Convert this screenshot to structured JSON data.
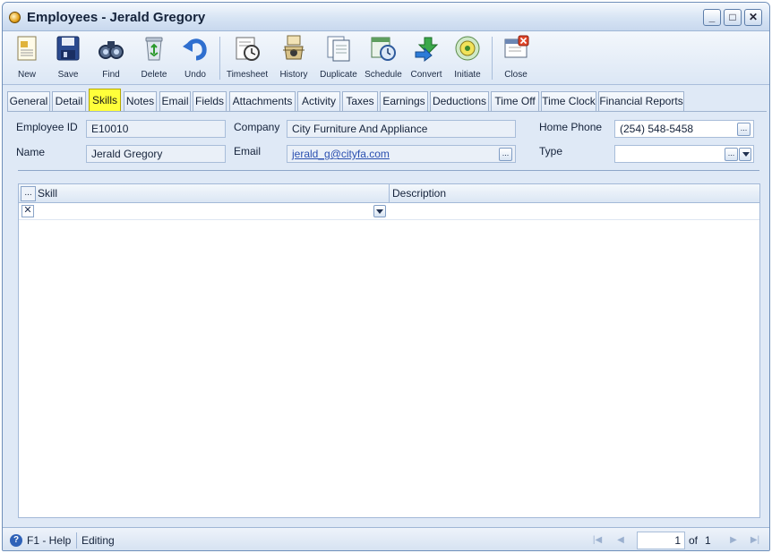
{
  "window": {
    "title": "Employees - Jerald Gregory"
  },
  "toolbar": {
    "buttons": [
      {
        "label": "New",
        "icon": "new-document-icon"
      },
      {
        "label": "Save",
        "icon": "floppy-disk-icon"
      },
      {
        "label": "Find",
        "icon": "binoculars-icon"
      },
      {
        "label": "Delete",
        "icon": "recycle-bin-icon"
      },
      {
        "label": "Undo",
        "icon": "undo-arrow-icon"
      },
      {
        "label": "Timesheet",
        "icon": "timesheet-clock-icon"
      },
      {
        "label": "History",
        "icon": "history-icon"
      },
      {
        "label": "Duplicate",
        "icon": "duplicate-icon"
      },
      {
        "label": "Schedule",
        "icon": "schedule-icon"
      },
      {
        "label": "Convert",
        "icon": "convert-arrows-icon"
      },
      {
        "label": "Initiate",
        "icon": "initiate-icon"
      },
      {
        "label": "Close",
        "icon": "close-window-icon"
      }
    ]
  },
  "tabs": [
    "General",
    "Detail",
    "Skills",
    "Notes",
    "Email",
    "Fields",
    "Attachments",
    "Activity",
    "Taxes",
    "Earnings",
    "Deductions",
    "Time Off",
    "Time Clock",
    "Financial Reports"
  ],
  "active_tab": "Skills",
  "form": {
    "employee_id_label": "Employee ID",
    "employee_id": "E10010",
    "name_label": "Name",
    "name": "Jerald Gregory",
    "company_label": "Company",
    "company": "City Furniture And Appliance",
    "email_label": "Email",
    "email": "jerald_g@cityfa.com",
    "home_phone_label": "Home Phone",
    "home_phone": "(254) 548-5458",
    "type_label": "Type",
    "type": "",
    "ellipsis": "..."
  },
  "grid": {
    "header_button": "...",
    "columns": [
      "Skill",
      "Description"
    ],
    "rows": [
      {
        "skill": "",
        "description": ""
      }
    ],
    "row_delete": "✕"
  },
  "status": {
    "help": "F1 - Help",
    "state": "Editing",
    "page": "1",
    "of_label": "of",
    "total_pages": "1"
  },
  "colors": {
    "active_tab": "#ffff3a",
    "window_bg": "#dfe9f6",
    "link": "#2a4fb0"
  }
}
